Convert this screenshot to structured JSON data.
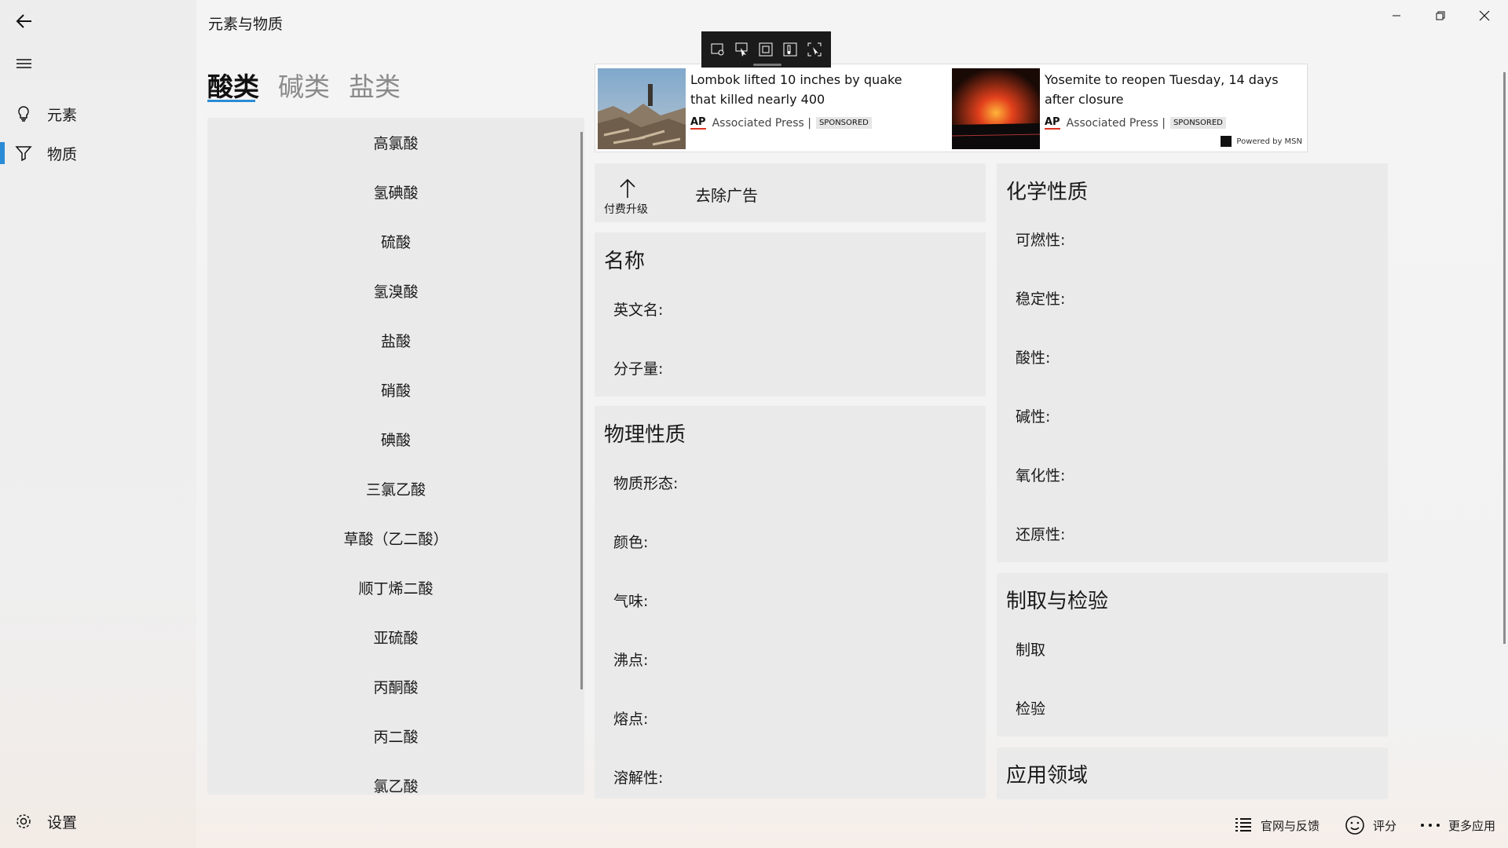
{
  "app": {
    "title": "元素与物质"
  },
  "nav": {
    "items": [
      {
        "label": "元素",
        "icon": "lightbulb-icon"
      },
      {
        "label": "物质",
        "icon": "filter-icon"
      }
    ],
    "settings_label": "设置"
  },
  "tabs": [
    "酸类",
    "碱类",
    "盐类"
  ],
  "list": [
    "高氯酸",
    "氢碘酸",
    "硫酸",
    "氢溴酸",
    "盐酸",
    "硝酸",
    "碘酸",
    "三氯乙酸",
    "草酸（乙二酸）",
    "顺丁烯二酸",
    "亚硫酸",
    "丙酮酸",
    "丙二酸",
    "氯乙酸"
  ],
  "ads": [
    {
      "headline": "Lombok lifted 10 inches by quake that killed nearly 400",
      "source_logo": "AP",
      "source": "Associated Press |",
      "badge": "SPONSORED"
    },
    {
      "headline": "Yosemite to reopen Tuesday, 14 days after closure",
      "source_logo": "AP",
      "source": "Associated Press |",
      "badge": "SPONSORED"
    }
  ],
  "powered_by": "Powered by MSN",
  "upgrade": {
    "label": "付费升级",
    "remove_ads": "去除广告"
  },
  "name_card": {
    "title": "名称",
    "fields": [
      "英文名:",
      "分子量:"
    ]
  },
  "physical_card": {
    "title": "物理性质",
    "fields": [
      "物质形态:",
      "颜色:",
      "气味:",
      "沸点:",
      "熔点:",
      "溶解性:"
    ]
  },
  "chemical_card": {
    "title": "化学性质",
    "fields": [
      "可燃性:",
      "稳定性:",
      "酸性:",
      "碱性:",
      "氧化性:",
      "还原性:"
    ]
  },
  "prep_card": {
    "title": "制取与检验",
    "fields": [
      "制取",
      "检验"
    ]
  },
  "app_card": {
    "title": "应用领域"
  },
  "footer": {
    "website": "官网与反馈",
    "rate": "评分",
    "more": "更多应用"
  },
  "colors": {
    "accent": "#2a8bd6",
    "list_bg": "#eaeaea",
    "toolbar_bg": "#1b1b1b"
  }
}
